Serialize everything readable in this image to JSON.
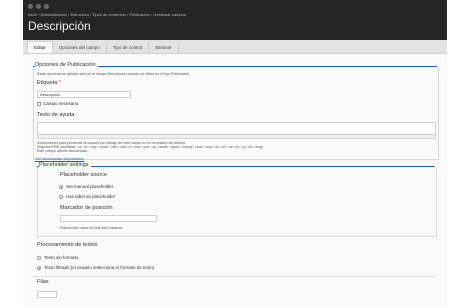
{
  "header": {
    "breadcrumb": "Inicio › Administración › Estructura › Tipos de contenido › Publicación › Gestionar campos",
    "title": "Descripción"
  },
  "tabs": [
    {
      "label": "Editar",
      "active": true
    },
    {
      "label": "Opciones del campo",
      "active": false
    },
    {
      "label": "Tipo de control",
      "active": false
    },
    {
      "label": "Eliminar",
      "active": false
    }
  ],
  "publication_settings": {
    "legend": "Opciones de Publicación",
    "intro": "Estas opciones se aplican sólo en el campo Descripción cuando se utiliza en el tipo Publicación.",
    "label_title": "Etiqueta",
    "label_value": "Descripción",
    "required_label": "Campo necesario",
    "help_title": "Texto de ayuda",
    "help_desc_1": "Instrucciones para presentar al usuario por debajo de este campo en el formulario de edición.",
    "help_desc_2": "Etiquetas HTML permitidas: <a> <b> <big> <code> <del> <em> <i> <ins> <pre> <q> <small> <span> <strong> <sub> <sup> <tt> <ol> <ul> <li> <p> <br> <img>",
    "help_desc_3": "Este campo admite secuencias.",
    "tokens_link": "Ver secuencias disponibles."
  },
  "placeholder_settings": {
    "legend": "Placeholder settings",
    "source_title": "Placeholder source",
    "options": [
      {
        "label": "Set manual placeholder",
        "selected": true
      },
      {
        "label": "Use label as placeholder",
        "selected": false
      }
    ],
    "marker_title": "Marcador de posición",
    "marker_desc": "Placeholder value for this field instance."
  },
  "text_processing": {
    "title": "Procesamiento de textos",
    "options": [
      {
        "label": "Texto sin formato",
        "selected": false
      },
      {
        "label": "Texto filtrado (el usuario selecciona el formato de texto)",
        "selected": true
      }
    ]
  },
  "rows": {
    "title": "Filas"
  }
}
